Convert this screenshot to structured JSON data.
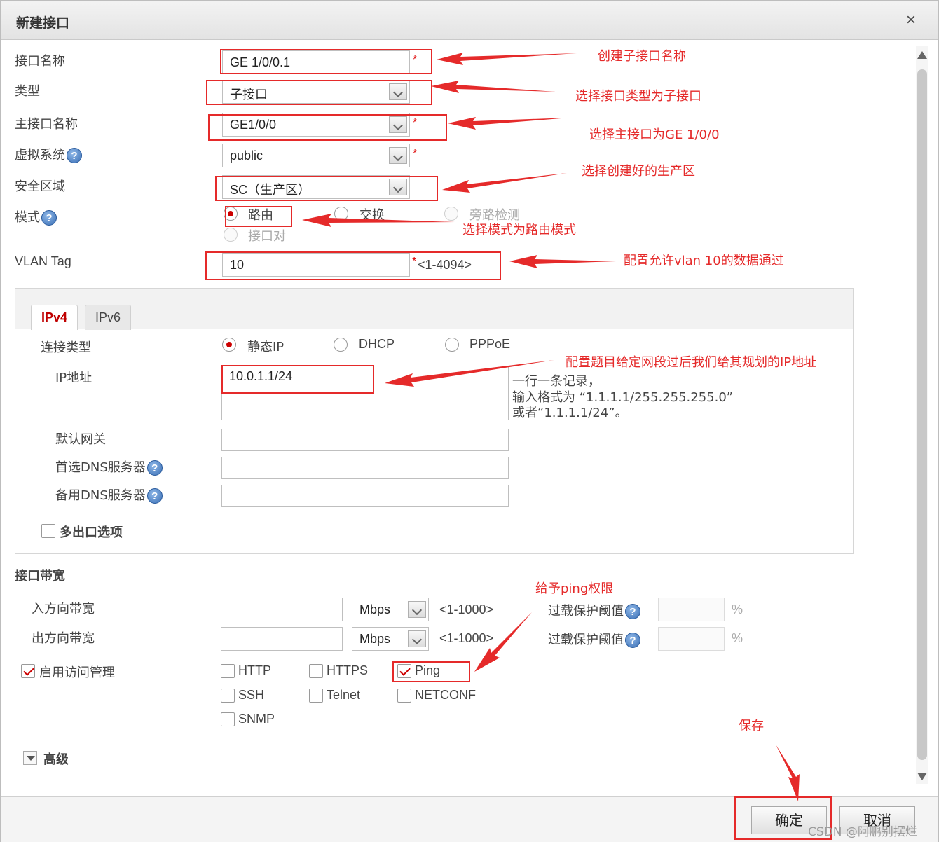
{
  "dialog": {
    "title": "新建接口",
    "close": "×"
  },
  "form": {
    "name_label": "接口名称",
    "name_value": "GE 1/0/0.1",
    "type_label": "类型",
    "type_value": "子接口",
    "parent_label": "主接口名称",
    "parent_value": "GE1/0/0",
    "vsys_label": "虚拟系统",
    "vsys_value": "public",
    "zone_label": "安全区域",
    "zone_value": "SC（生产区）",
    "mode_label": "模式",
    "mode_options": [
      "路由",
      "交换",
      "旁路检测",
      "接口对"
    ],
    "vlan_label": "VLAN Tag",
    "vlan_value": "10",
    "vlan_range": "<1-4094>",
    "required_mark": "*",
    "help": "?"
  },
  "ipv4_panel": {
    "tabs": [
      "IPv4",
      "IPv6"
    ],
    "conn_type_label": "连接类型",
    "conn_options": [
      "静态IP",
      "DHCP",
      "PPPoE"
    ],
    "ip_label": "IP地址",
    "ip_value": "10.0.1.1/24",
    "ip_hint_1": "一行一条记录，",
    "ip_hint_2": "输入格式为 “1.1.1.1/255.255.255.0”",
    "ip_hint_3": "或者“1.1.1.1/24”。",
    "gateway_label": "默认网关",
    "dns1_label": "首选DNS服务器",
    "dns2_label": "备用DNS服务器",
    "multi_exit_label": "多出口选项"
  },
  "bandwidth": {
    "section_label": "接口带宽",
    "in_label": "入方向带宽",
    "out_label": "出方向带宽",
    "unit": "Mbps",
    "range": "<1-1000>",
    "overload_label": "过载保护阈值",
    "percent": "%"
  },
  "access": {
    "label": "启用访问管理",
    "services": [
      "HTTP",
      "HTTPS",
      "Ping",
      "SSH",
      "Telnet",
      "NETCONF",
      "SNMP"
    ]
  },
  "advanced_label": "高级",
  "buttons": {
    "ok": "确定",
    "cancel": "取消"
  },
  "annotations": {
    "a1": "创建子接口名称",
    "a2": "选择接口类型为子接口",
    "a3": "选择主接口为GE 1/0/0",
    "a4": "选择创建好的生产区",
    "a5": "选择模式为路由模式",
    "a6": "配置允许vlan 10的数据通过",
    "a7": "配置题目给定网段过后我们给其规划的IP地址",
    "a8": "给予ping权限",
    "a9": "保存"
  },
  "watermark": "CSDN @阿鹏别摆烂",
  "colors": {
    "annotation_red": "#e52a2a",
    "tab_active_red": "#c00000",
    "check_red": "#cc0000"
  }
}
